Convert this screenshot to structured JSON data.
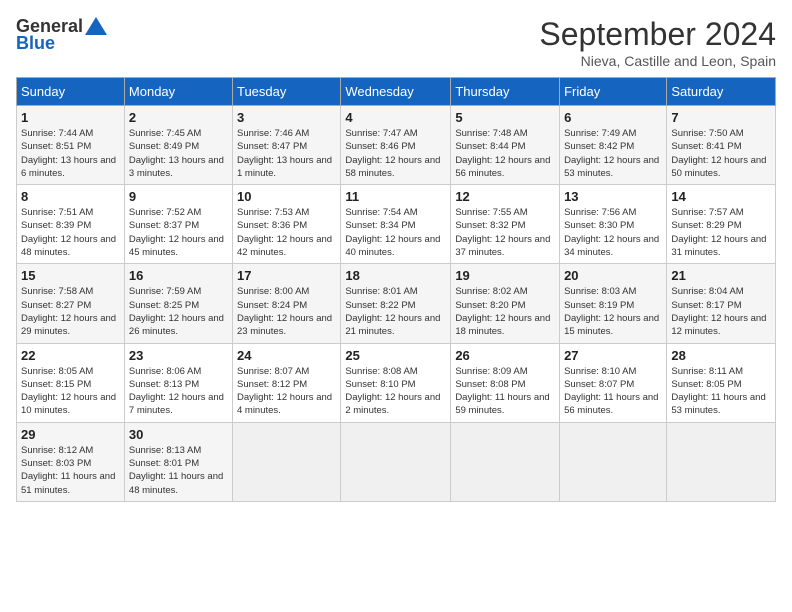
{
  "logo": {
    "general": "General",
    "blue": "Blue"
  },
  "title": "September 2024",
  "location": "Nieva, Castille and Leon, Spain",
  "days_of_week": [
    "Sunday",
    "Monday",
    "Tuesday",
    "Wednesday",
    "Thursday",
    "Friday",
    "Saturday"
  ],
  "weeks": [
    [
      {
        "day": "1",
        "sunrise": "7:44 AM",
        "sunset": "8:51 PM",
        "daylight": "13 hours and 6 minutes."
      },
      {
        "day": "2",
        "sunrise": "7:45 AM",
        "sunset": "8:49 PM",
        "daylight": "13 hours and 3 minutes."
      },
      {
        "day": "3",
        "sunrise": "7:46 AM",
        "sunset": "8:47 PM",
        "daylight": "13 hours and 1 minute."
      },
      {
        "day": "4",
        "sunrise": "7:47 AM",
        "sunset": "8:46 PM",
        "daylight": "12 hours and 58 minutes."
      },
      {
        "day": "5",
        "sunrise": "7:48 AM",
        "sunset": "8:44 PM",
        "daylight": "12 hours and 56 minutes."
      },
      {
        "day": "6",
        "sunrise": "7:49 AM",
        "sunset": "8:42 PM",
        "daylight": "12 hours and 53 minutes."
      },
      {
        "day": "7",
        "sunrise": "7:50 AM",
        "sunset": "8:41 PM",
        "daylight": "12 hours and 50 minutes."
      }
    ],
    [
      {
        "day": "8",
        "sunrise": "7:51 AM",
        "sunset": "8:39 PM",
        "daylight": "12 hours and 48 minutes."
      },
      {
        "day": "9",
        "sunrise": "7:52 AM",
        "sunset": "8:37 PM",
        "daylight": "12 hours and 45 minutes."
      },
      {
        "day": "10",
        "sunrise": "7:53 AM",
        "sunset": "8:36 PM",
        "daylight": "12 hours and 42 minutes."
      },
      {
        "day": "11",
        "sunrise": "7:54 AM",
        "sunset": "8:34 PM",
        "daylight": "12 hours and 40 minutes."
      },
      {
        "day": "12",
        "sunrise": "7:55 AM",
        "sunset": "8:32 PM",
        "daylight": "12 hours and 37 minutes."
      },
      {
        "day": "13",
        "sunrise": "7:56 AM",
        "sunset": "8:30 PM",
        "daylight": "12 hours and 34 minutes."
      },
      {
        "day": "14",
        "sunrise": "7:57 AM",
        "sunset": "8:29 PM",
        "daylight": "12 hours and 31 minutes."
      }
    ],
    [
      {
        "day": "15",
        "sunrise": "7:58 AM",
        "sunset": "8:27 PM",
        "daylight": "12 hours and 29 minutes."
      },
      {
        "day": "16",
        "sunrise": "7:59 AM",
        "sunset": "8:25 PM",
        "daylight": "12 hours and 26 minutes."
      },
      {
        "day": "17",
        "sunrise": "8:00 AM",
        "sunset": "8:24 PM",
        "daylight": "12 hours and 23 minutes."
      },
      {
        "day": "18",
        "sunrise": "8:01 AM",
        "sunset": "8:22 PM",
        "daylight": "12 hours and 21 minutes."
      },
      {
        "day": "19",
        "sunrise": "8:02 AM",
        "sunset": "8:20 PM",
        "daylight": "12 hours and 18 minutes."
      },
      {
        "day": "20",
        "sunrise": "8:03 AM",
        "sunset": "8:19 PM",
        "daylight": "12 hours and 15 minutes."
      },
      {
        "day": "21",
        "sunrise": "8:04 AM",
        "sunset": "8:17 PM",
        "daylight": "12 hours and 12 minutes."
      }
    ],
    [
      {
        "day": "22",
        "sunrise": "8:05 AM",
        "sunset": "8:15 PM",
        "daylight": "12 hours and 10 minutes."
      },
      {
        "day": "23",
        "sunrise": "8:06 AM",
        "sunset": "8:13 PM",
        "daylight": "12 hours and 7 minutes."
      },
      {
        "day": "24",
        "sunrise": "8:07 AM",
        "sunset": "8:12 PM",
        "daylight": "12 hours and 4 minutes."
      },
      {
        "day": "25",
        "sunrise": "8:08 AM",
        "sunset": "8:10 PM",
        "daylight": "12 hours and 2 minutes."
      },
      {
        "day": "26",
        "sunrise": "8:09 AM",
        "sunset": "8:08 PM",
        "daylight": "11 hours and 59 minutes."
      },
      {
        "day": "27",
        "sunrise": "8:10 AM",
        "sunset": "8:07 PM",
        "daylight": "11 hours and 56 minutes."
      },
      {
        "day": "28",
        "sunrise": "8:11 AM",
        "sunset": "8:05 PM",
        "daylight": "11 hours and 53 minutes."
      }
    ],
    [
      {
        "day": "29",
        "sunrise": "8:12 AM",
        "sunset": "8:03 PM",
        "daylight": "11 hours and 51 minutes."
      },
      {
        "day": "30",
        "sunrise": "8:13 AM",
        "sunset": "8:01 PM",
        "daylight": "11 hours and 48 minutes."
      },
      null,
      null,
      null,
      null,
      null
    ]
  ]
}
